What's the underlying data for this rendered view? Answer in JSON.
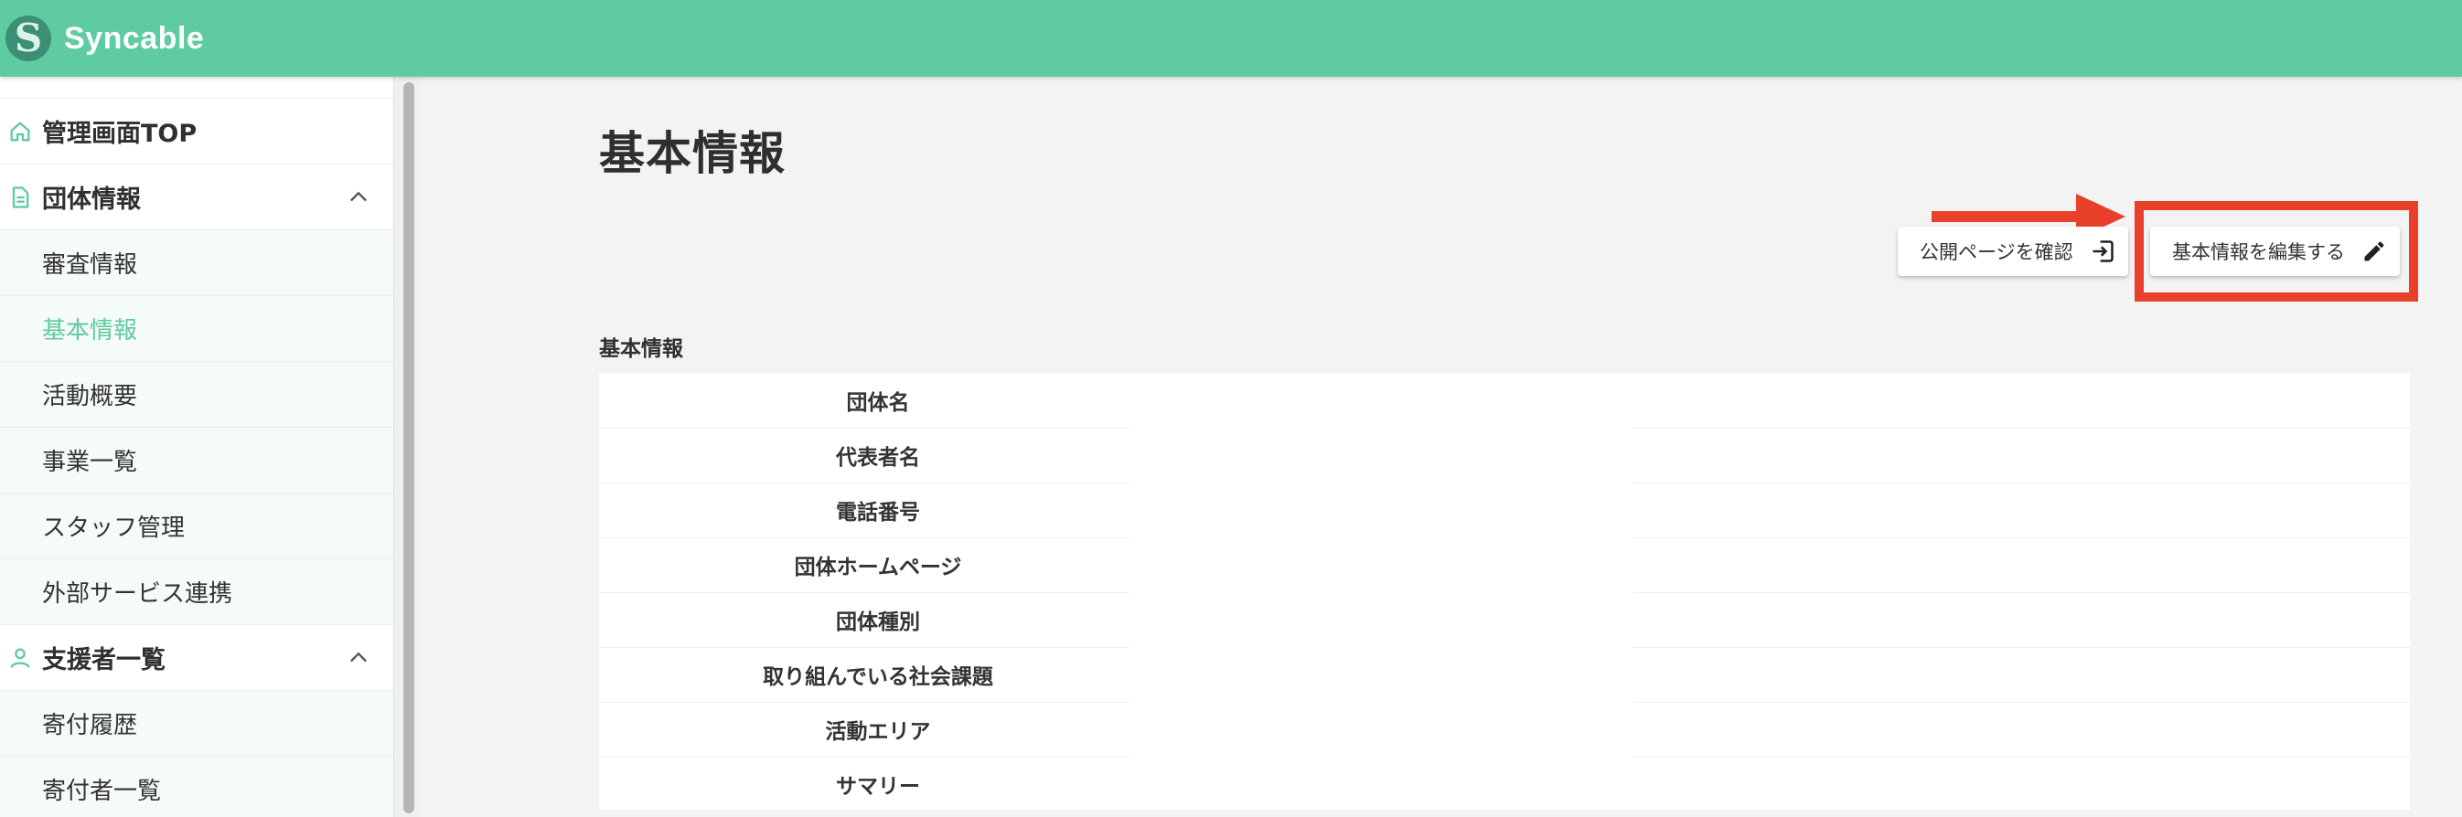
{
  "app": {
    "name": "Syncable",
    "logo_letter": "S"
  },
  "colors": {
    "brand": "#5ecba1",
    "highlight": "#e8402a"
  },
  "sidebar": {
    "items": [
      {
        "label": "管理画面TOP",
        "icon": "home-icon",
        "type": "top"
      },
      {
        "label": "団体情報",
        "icon": "document-icon",
        "type": "group",
        "expanded": true
      },
      {
        "label": "審査情報",
        "type": "sub"
      },
      {
        "label": "基本情報",
        "type": "sub",
        "active": true
      },
      {
        "label": "活動概要",
        "type": "sub"
      },
      {
        "label": "事業一覧",
        "type": "sub"
      },
      {
        "label": "スタッフ管理",
        "type": "sub"
      },
      {
        "label": "外部サービス連携",
        "type": "sub"
      },
      {
        "label": "支援者一覧",
        "icon": "person-icon",
        "type": "group",
        "expanded": true
      },
      {
        "label": "寄付履歴",
        "type": "sub"
      },
      {
        "label": "寄付者一覧",
        "type": "sub"
      }
    ]
  },
  "main": {
    "title": "基本情報",
    "buttons": {
      "public_page": {
        "label": "公開ページを確認",
        "icon": "exit-to-app-icon"
      },
      "edit": {
        "label": "基本情報を編集する",
        "icon": "pencil-icon"
      }
    },
    "section_title": "基本情報",
    "fields": [
      {
        "label": "団体名",
        "value": ""
      },
      {
        "label": "代表者名",
        "value": ""
      },
      {
        "label": "電話番号",
        "value": ""
      },
      {
        "label": "団体ホームページ",
        "value": ""
      },
      {
        "label": "団体種別",
        "value": ""
      },
      {
        "label": "取り組んでいる社会課題",
        "value": ""
      },
      {
        "label": "活動エリア",
        "value": ""
      },
      {
        "label": "サマリー",
        "value": ""
      }
    ]
  }
}
